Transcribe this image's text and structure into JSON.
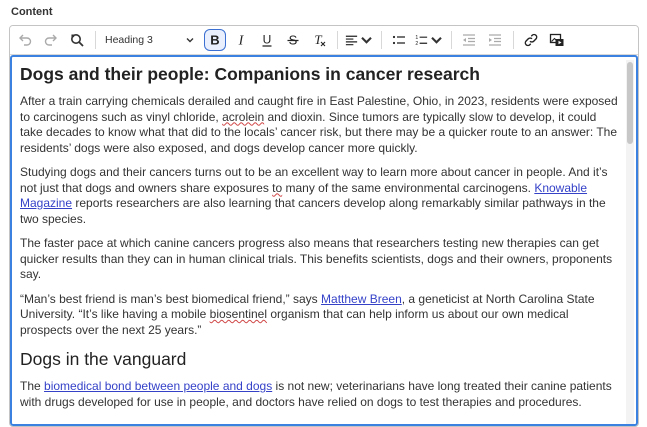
{
  "field_label": "Content",
  "toolbar": {
    "heading_select": "Heading 3",
    "icons": [
      "undo-icon",
      "redo-icon",
      "find-replace-icon",
      "bold-icon",
      "italic-icon",
      "underline-icon",
      "strikethrough-icon",
      "clear-formatting-icon",
      "align-icon",
      "bulleted-list-icon",
      "numbered-list-icon",
      "outdent-icon",
      "indent-icon",
      "link-icon",
      "media-icon"
    ]
  },
  "colors": {
    "accent": "#3b82e0",
    "link": "#3542c8",
    "active_button_border": "#3b6fd1"
  },
  "document": {
    "title": "Dogs and their people: Companions in cancer research",
    "p1": {
      "a": "After a train carrying chemicals derailed and caught fire in East Palestine, Ohio, in 2023, residents were exposed to carcinogens such as vinyl chloride, ",
      "misspelled": "acrolein",
      "b": " and dioxin. Since tumors are typically slow to develop, it could take decades to know what that did to the locals’ cancer risk, but there may be a quicker route to an answer: The residents’ dogs were also exposed, and dogs develop cancer more quickly."
    },
    "p2": {
      "a": "Studying dogs and their cancers turns out to be an excellent way to learn more about cancer in people. And it’s not just that dogs and owners share exposures ",
      "underlined": "to",
      "b": " many of the same environmental carcinogens. ",
      "link": "Knowable Magazine",
      "c": " reports researchers are also learning that cancers develop along remarkably similar pathways in the two species."
    },
    "p3": "The faster pace at which canine cancers progress also means that researchers testing new therapies can get quicker results than they can in human clinical trials. This benefits scientists, dogs and their owners, proponents say.",
    "p4": {
      "a": "“Man’s best friend is man’s best biomedical friend,” says ",
      "link": "Matthew Breen",
      "b": ", a geneticist at North Carolina State University. “It’s like having a mobile ",
      "misspelled": "biosentinel",
      "c": " organism that can help inform us about our own medical prospects over the next 25 years.”"
    },
    "subheading": "Dogs in the vanguard",
    "p5": {
      "a": "The ",
      "link": "biomedical bond between people and dogs",
      "b": " is not new; veterinarians have long treated their canine patients with drugs developed for use in people, and doctors have relied on dogs to test therapies and procedures."
    }
  }
}
